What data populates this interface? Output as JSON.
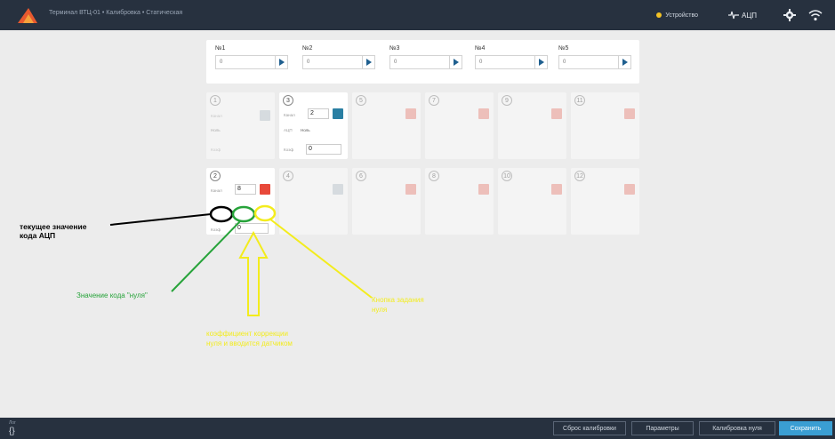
{
  "header": {
    "breadcrumb": "Терминал ВТЦ-01 • Калибровка • Статическая",
    "device_label": "Устройство",
    "adc_label": "АЦП"
  },
  "sensors": [
    {
      "label": "№1",
      "value": "0"
    },
    {
      "label": "№2",
      "value": "0"
    },
    {
      "label": "№3",
      "value": "0"
    },
    {
      "label": "№4",
      "value": "0"
    },
    {
      "label": "№5",
      "value": "0"
    }
  ],
  "cards": {
    "c1": {
      "num": "1",
      "kod_label": "Канал",
      "nul_label": "Ноль",
      "k_label": "Коэф"
    },
    "c3": {
      "num": "3",
      "kanal_label": "Канал",
      "kanal_val": "2",
      "adc": "АЦП",
      "nul": "Ноль",
      "koef": "Коэф",
      "koef_val": "0"
    },
    "c5": {
      "num": "5"
    },
    "c7": {
      "num": "7"
    },
    "c9": {
      "num": "9"
    },
    "c11": {
      "num": "11"
    },
    "c2": {
      "num": "2",
      "kanal_label": "Канал",
      "kanal_val": "8",
      "koef_label": "Коэф",
      "koef_val": "0"
    },
    "c4": {
      "num": "4"
    },
    "c6": {
      "num": "6"
    },
    "c8": {
      "num": "8"
    },
    "c10": {
      "num": "10"
    },
    "c12": {
      "num": "12"
    }
  },
  "annotations": {
    "adc_line1": "текущее значение",
    "adc_line2": "кода АЦП",
    "zero_code": "Значение кода \"нуля\"",
    "yellow_right_1": "Кнопка задания",
    "yellow_right_2": "нуля",
    "yellow_bottom_1": "коэффициент коррекции",
    "yellow_bottom_2": "нуля и вводится датчиком"
  },
  "footer": {
    "left_label": "Лог",
    "left_brace": "{}",
    "reset": "Сброс калибровки",
    "params": "Параметры",
    "zero_cal": "Калибровка нуля",
    "save": "Сохранить"
  },
  "colors": {
    "topbar": "#27313f",
    "accent_blue": "#2a7fa3",
    "danger_red": "#e8493a",
    "save_blue": "#3a9ed3",
    "annot_black": "#000000",
    "annot_green": "#27a33a",
    "annot_yellow": "#f3ec1d"
  }
}
